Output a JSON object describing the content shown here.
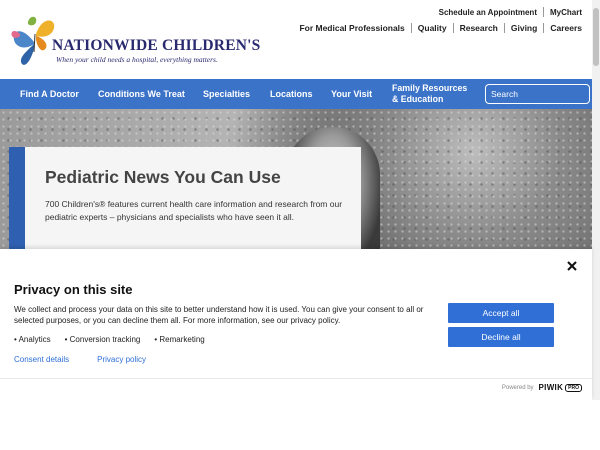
{
  "header": {
    "logo_name": "NATIONWIDE CHILDREN'S",
    "logo_tagline": "When your child needs a hospital, everything matters.",
    "top_links": [
      "Schedule an Appointment",
      "MyChart"
    ],
    "secondary_links": [
      "For Medical Professionals",
      "Quality",
      "Research",
      "Giving",
      "Careers"
    ]
  },
  "nav": {
    "items": [
      "Find A Doctor",
      "Conditions We Treat",
      "Specialties",
      "Locations",
      "Your Visit"
    ],
    "family_line1": "Family Resources",
    "family_line2": "& Education",
    "search_placeholder": "Search"
  },
  "hero": {
    "title": "Pediatric News You Can Use",
    "description": "700 Children's® features current health care information and research from our pediatric experts – physicians and specialists who have seen it all."
  },
  "consent": {
    "title": "Privacy on this site",
    "text": "We collect and process your data on this site to better understand how it is used. You can give your consent to all or selected purposes, or you can decline them all. For more information, see our privacy policy.",
    "purposes": [
      "Analytics",
      "Conversion tracking",
      "Remarketing"
    ],
    "links": [
      "Consent details",
      "Privacy policy"
    ],
    "accept_label": "Accept all",
    "decline_label": "Decline all",
    "powered_by": "Powered by",
    "brand": "PIWIK",
    "brand_badge": "PRO"
  },
  "colors": {
    "nav_blue": "#3b73c8",
    "button_blue": "#2f6fd6",
    "accent_blue": "#2f5fb0",
    "logo_navy": "#2a2a6e"
  }
}
